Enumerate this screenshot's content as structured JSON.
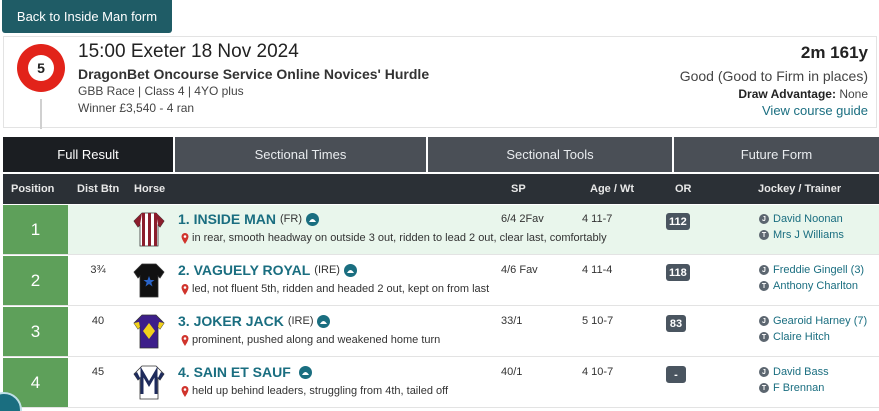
{
  "back_button": {
    "label": "Back to Inside Man form"
  },
  "race": {
    "number": "5",
    "title": "15:00 Exeter 18 Nov 2024",
    "name": "DragonBet Oncourse Service Online Novices' Hurdle",
    "meta": "GBB Race | Class 4 | 4YO plus",
    "winner": "Winner £3,540 - 4 ran",
    "distance": "2m 161y",
    "going": "Good (Good to Firm in places)",
    "draw_label": "Draw Advantage:",
    "draw_value": "None",
    "course_link": "View course guide"
  },
  "tabs": [
    {
      "label": "Full Result",
      "active": true
    },
    {
      "label": "Sectional Times",
      "active": false
    },
    {
      "label": "Sectional Tools",
      "active": false
    },
    {
      "label": "Future Form",
      "active": false
    }
  ],
  "columns": {
    "position": "Position",
    "dist_btn": "Dist Btn",
    "horse": "Horse",
    "sp": "SP",
    "age_wt": "Age / Wt",
    "or": "OR",
    "jockey_trainer": "Jockey / Trainer"
  },
  "colors": {
    "pos_1": "#5ea05a",
    "pos_2": "#5ea05a",
    "pos_3": "#5ea05a",
    "pos_4": "#5ea05a",
    "accent": "#1a6e80",
    "badge_red": "#e2231a"
  },
  "runners": [
    {
      "position": "1",
      "dist_btn": "",
      "name": "1. INSIDE MAN",
      "country": "(FR)",
      "comment": "in rear, smooth headway on outside 3 out, ridden to lead 2 out, clear last, comfortably",
      "sp": "6/4 2Fav",
      "age_wt": "4 11-7",
      "or": "112",
      "jockey": "David Noonan",
      "trainer": "Mrs J Williams",
      "silk": "maroon-white-stripes"
    },
    {
      "position": "2",
      "dist_btn": "3¾",
      "name": "2. VAGUELY ROYAL",
      "country": "(IRE)",
      "comment": "led, not fluent 5th, ridden and headed 2 out, kept on from last",
      "sp": "4/6 Fav",
      "age_wt": "4 11-4",
      "or": "118",
      "jockey": "Freddie Gingell (3)",
      "trainer": "Anthony Charlton",
      "silk": "black-blue-star"
    },
    {
      "position": "3",
      "dist_btn": "40",
      "name": "3. JOKER JACK",
      "country": "(IRE)",
      "comment": "prominent, pushed along and weakened home turn",
      "sp": "33/1",
      "age_wt": "5 10-7",
      "or": "83",
      "jockey": "Gearoid Harney (7)",
      "trainer": "Claire Hitch",
      "silk": "purple-yellow-diamond"
    },
    {
      "position": "4",
      "dist_btn": "45",
      "name": "4. SAIN ET SAUF",
      "country": "",
      "comment": "held up behind leaders, struggling from 4th, tailed off",
      "sp": "40/1",
      "age_wt": "4 10-7",
      "or": "-",
      "jockey": "David Bass",
      "trainer": "F Brennan",
      "silk": "white-navy-m"
    }
  ]
}
